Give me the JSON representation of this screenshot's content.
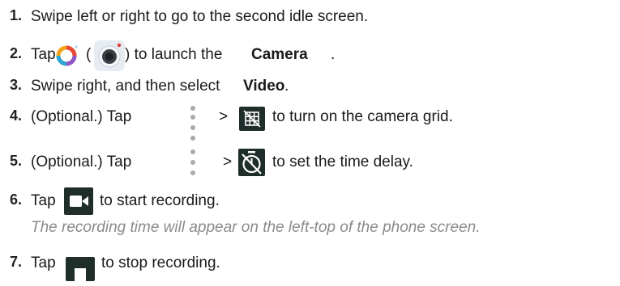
{
  "steps": [
    {
      "num": "1.",
      "pre": "Swipe left or right to go to the second idle screen."
    },
    {
      "num": "2.",
      "pre": "Tap",
      "open_paren": "(",
      "mid": ") to launch the ",
      "bold": "Camera",
      "post": "."
    },
    {
      "num": "3.",
      "pre": "Swipe right, and then select ",
      "bold": "Video",
      "post": "."
    },
    {
      "num": "4.",
      "pre": "(Optional.) Tap",
      "gt": ">",
      "post": "to turn on the camera grid."
    },
    {
      "num": "5.",
      "pre": "(Optional.) Tap",
      "gt": ">",
      "post": "to set the time delay."
    },
    {
      "num": "6.",
      "pre": "Tap",
      "post": "to start recording."
    },
    {
      "num": "7.",
      "pre": "Tap",
      "post": "to stop recording."
    }
  ],
  "note": "The recording time will appear on the left-top of the phone screen.",
  "icons": {
    "camera_app": "camera-app-icon",
    "camera_lens": "camera-lens-icon",
    "more": "more-options-icon",
    "grid": "grid-icon",
    "timer": "timer-off-icon",
    "record": "video-record-icon",
    "stop": "stop-icon"
  },
  "colors": {
    "icon_dark": "#1f2d2b",
    "note": "#8a8a8a",
    "dots": "#a9a9a9"
  }
}
